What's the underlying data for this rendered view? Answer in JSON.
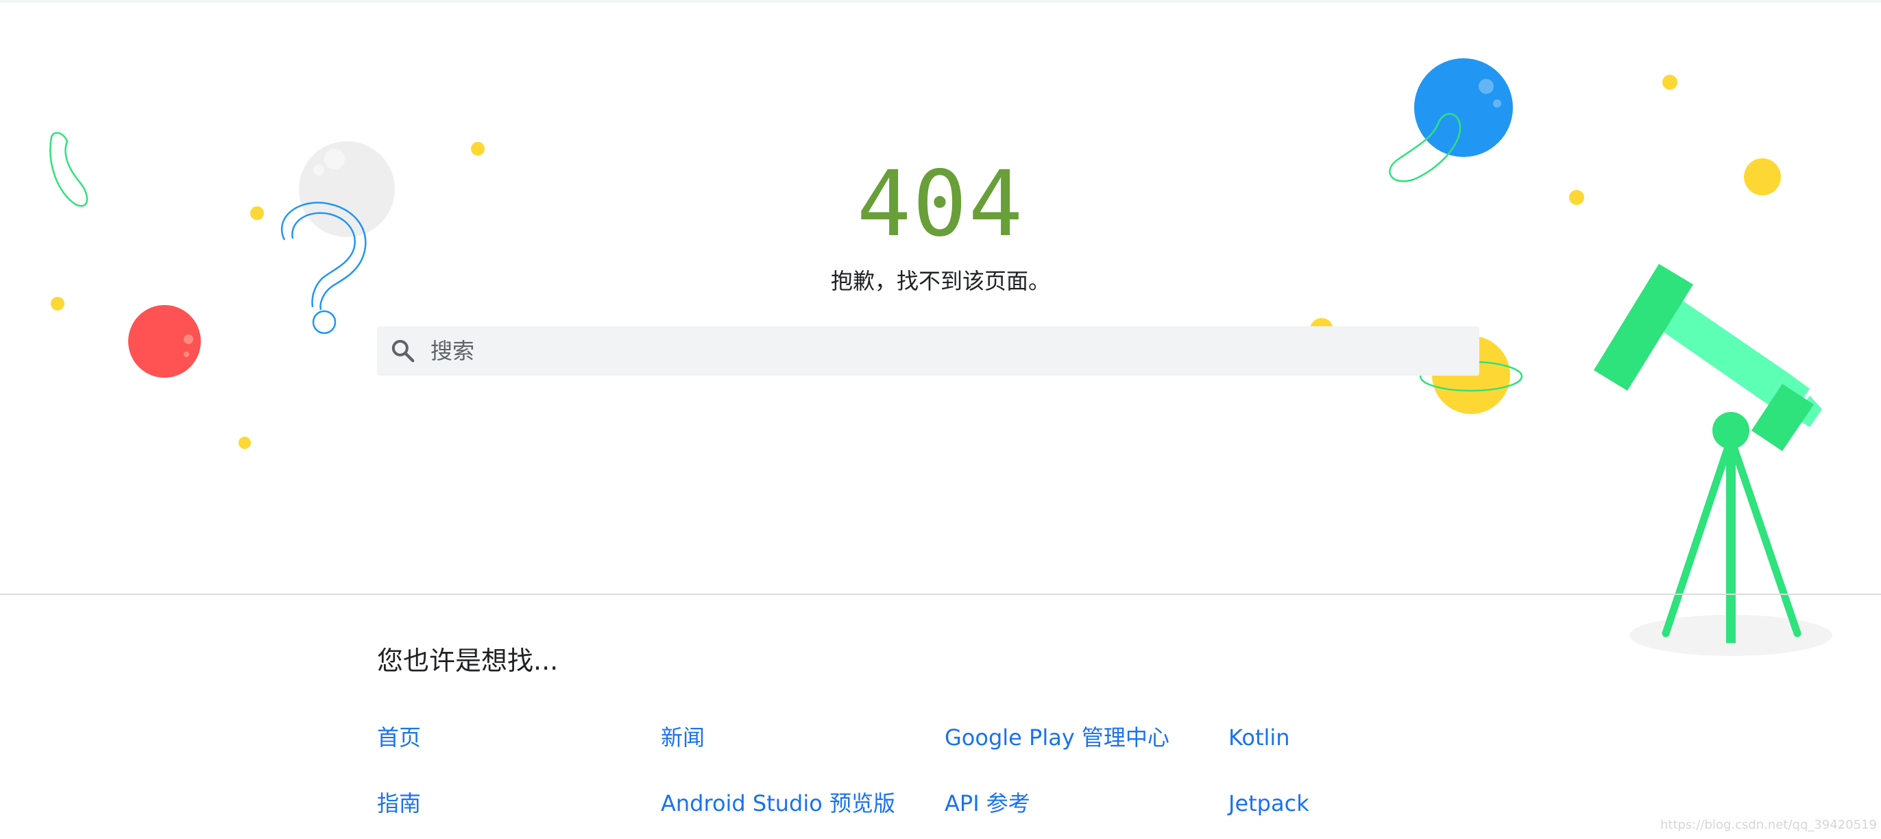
{
  "error": {
    "code": "404",
    "message": "抱歉，找不到该页面。"
  },
  "search": {
    "placeholder": "搜索",
    "value": "",
    "icon": "search-icon"
  },
  "suggestions": {
    "heading": "您也许是想找...",
    "links": [
      {
        "label": "首页"
      },
      {
        "label": "新闻"
      },
      {
        "label": "Google Play 管理中心"
      },
      {
        "label": "Kotlin"
      },
      {
        "label": "指南"
      },
      {
        "label": "Android Studio 预览版"
      },
      {
        "label": "API 参考"
      },
      {
        "label": "Jetpack"
      }
    ]
  },
  "watermark": "https://blog.csdn.net/qq_39420519",
  "colors": {
    "error_code": "#689f38",
    "link": "#1a73e8",
    "search_bg": "#f1f3f4",
    "planet_red": "#ff5252",
    "planet_blue": "#2196f3",
    "planet_yellow": "#fdd835",
    "telescope_green": "#2ee27c",
    "telescope_mint": "#5dffb5"
  }
}
